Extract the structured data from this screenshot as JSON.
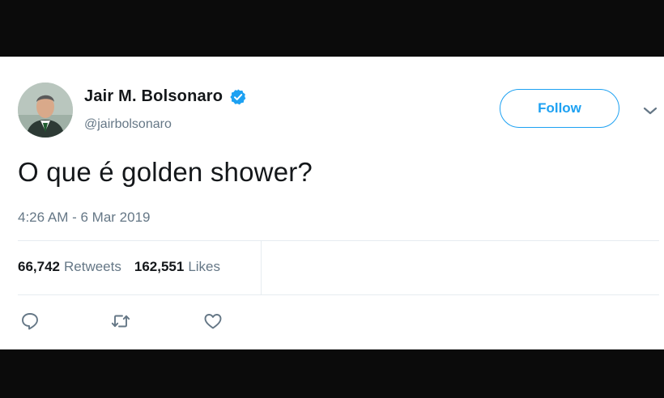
{
  "tweet": {
    "author": {
      "name": "Jair M. Bolsonaro",
      "handle": "@jairbolsonaro",
      "verified": true
    },
    "follow_label": "Follow",
    "text": "O que é golden shower?",
    "timestamp": "4:26 AM - 6 Mar 2019",
    "stats": {
      "retweets_count": "66,742",
      "retweets_label": "Retweets",
      "likes_count": "162,551",
      "likes_label": "Likes"
    }
  },
  "colors": {
    "accent": "#1da1f2",
    "text_primary": "#14171a",
    "text_secondary": "#657786",
    "letterbox": "#0b0b0b"
  },
  "icons": [
    "verified-badge-icon",
    "chevron-down-icon",
    "reply-icon",
    "retweet-icon",
    "like-icon"
  ]
}
